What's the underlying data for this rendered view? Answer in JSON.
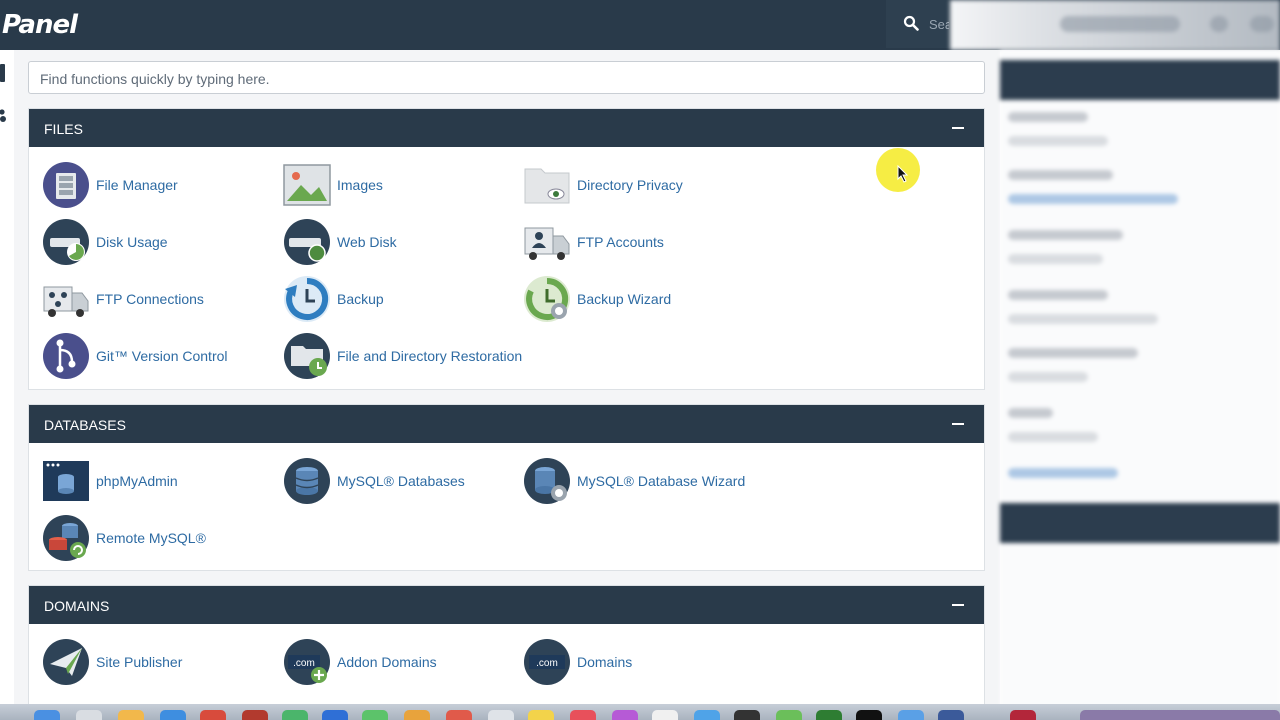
{
  "app": {
    "logo": "Panel"
  },
  "header": {
    "search_placeholder": "Sea"
  },
  "quick_search": {
    "placeholder": "Find functions quickly by typing here."
  },
  "sections": {
    "files": {
      "title": "FILES",
      "items": [
        {
          "label": "File Manager",
          "icon": "file-manager-icon"
        },
        {
          "label": "Images",
          "icon": "images-icon"
        },
        {
          "label": "Directory Privacy",
          "icon": "directory-privacy-icon"
        },
        {
          "label": "Disk Usage",
          "icon": "disk-usage-icon"
        },
        {
          "label": "Web Disk",
          "icon": "web-disk-icon"
        },
        {
          "label": "FTP Accounts",
          "icon": "ftp-accounts-icon"
        },
        {
          "label": "FTP Connections",
          "icon": "ftp-connections-icon"
        },
        {
          "label": "Backup",
          "icon": "backup-icon"
        },
        {
          "label": "Backup Wizard",
          "icon": "backup-wizard-icon"
        },
        {
          "label": "Git™ Version Control",
          "icon": "git-icon"
        },
        {
          "label": "File and Directory Restoration",
          "icon": "restoration-icon"
        }
      ]
    },
    "databases": {
      "title": "DATABASES",
      "items": [
        {
          "label": "phpMyAdmin",
          "icon": "phpmyadmin-icon"
        },
        {
          "label": "MySQL® Databases",
          "icon": "mysql-databases-icon"
        },
        {
          "label": "MySQL® Database Wizard",
          "icon": "mysql-wizard-icon"
        },
        {
          "label": "Remote MySQL®",
          "icon": "remote-mysql-icon"
        }
      ]
    },
    "domains": {
      "title": "DOMAINS",
      "items": [
        {
          "label": "Site Publisher",
          "icon": "site-publisher-icon"
        },
        {
          "label": "Addon Domains",
          "icon": "addon-domains-icon"
        },
        {
          "label": "Domains",
          "icon": "domains-icon"
        }
      ],
      "icon_text": ".com"
    }
  },
  "colors": {
    "header": "#293a4a",
    "link": "#2e6ba3",
    "highlight": "#f6ec3a"
  }
}
